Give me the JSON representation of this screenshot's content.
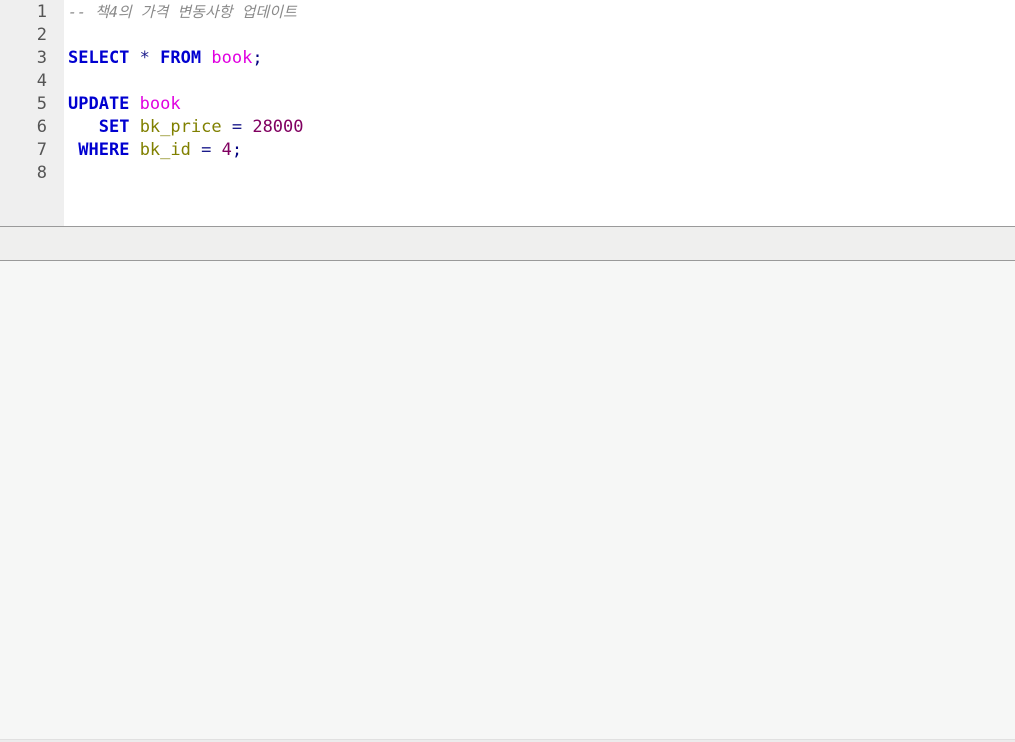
{
  "editor": {
    "line_numbers": [
      "1",
      "2",
      "3",
      "4",
      "5",
      "6",
      "7",
      "8"
    ],
    "lines": [
      [
        {
          "text": "-- 책4의 가격 변동사항 업데이트",
          "kind": "comment"
        }
      ],
      [],
      [
        {
          "text": "SELECT",
          "kind": "kw"
        },
        {
          "text": " ",
          "kind": "plain"
        },
        {
          "text": "*",
          "kind": "op"
        },
        {
          "text": " ",
          "kind": "plain"
        },
        {
          "text": "FROM",
          "kind": "kw"
        },
        {
          "text": " ",
          "kind": "plain"
        },
        {
          "text": "book",
          "kind": "table"
        },
        {
          "text": ";",
          "kind": "punc"
        }
      ],
      [],
      [
        {
          "text": "UPDATE",
          "kind": "kw"
        },
        {
          "text": " ",
          "kind": "plain"
        },
        {
          "text": "book",
          "kind": "table"
        }
      ],
      [
        {
          "text": "   ",
          "kind": "plain"
        },
        {
          "text": "SET",
          "kind": "kw"
        },
        {
          "text": " ",
          "kind": "plain"
        },
        {
          "text": "bk_price",
          "kind": "col"
        },
        {
          "text": " ",
          "kind": "plain"
        },
        {
          "text": "=",
          "kind": "op"
        },
        {
          "text": " ",
          "kind": "plain"
        },
        {
          "text": "28000",
          "kind": "num"
        }
      ],
      [
        {
          "text": " ",
          "kind": "plain"
        },
        {
          "text": "WHERE",
          "kind": "kw"
        },
        {
          "text": " ",
          "kind": "plain"
        },
        {
          "text": "bk_id",
          "kind": "col"
        },
        {
          "text": " ",
          "kind": "plain"
        },
        {
          "text": "=",
          "kind": "op"
        },
        {
          "text": " ",
          "kind": "plain"
        },
        {
          "text": "4",
          "kind": "num"
        },
        {
          "text": ";",
          "kind": "punc"
        }
      ],
      []
    ]
  }
}
